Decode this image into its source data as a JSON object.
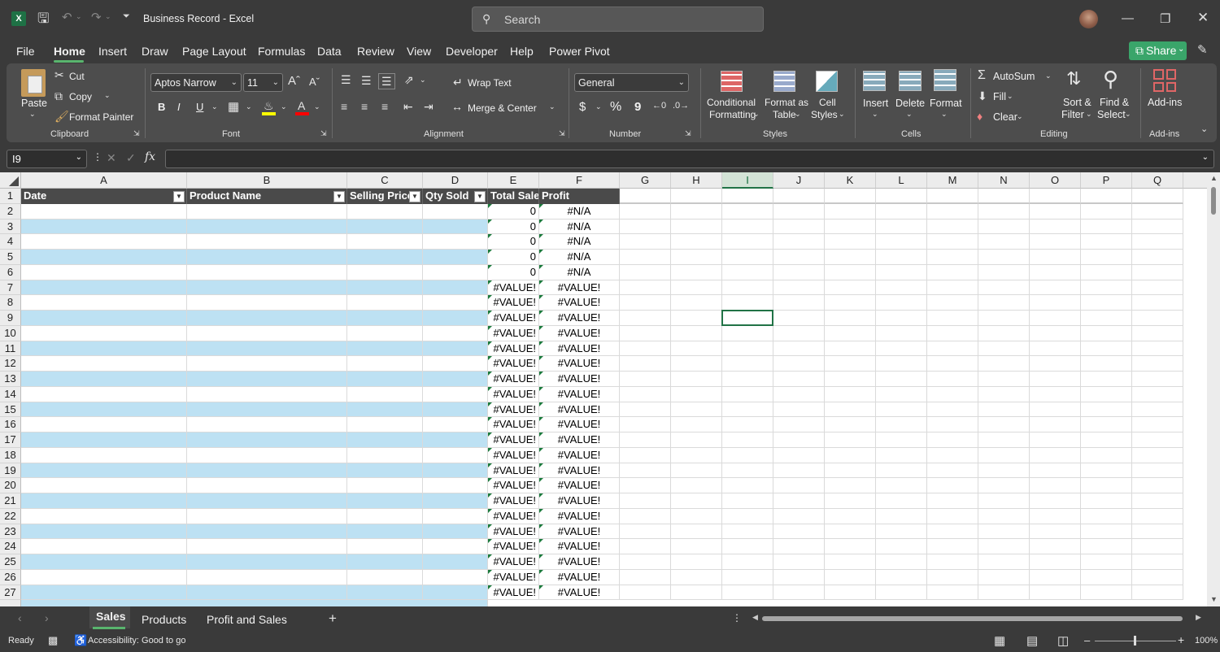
{
  "app": {
    "title": "Business Record  -  Excel",
    "search_placeholder": "Search"
  },
  "menu_tabs": [
    "File",
    "Home",
    "Insert",
    "Draw",
    "Page Layout",
    "Formulas",
    "Data",
    "Review",
    "View",
    "Developer",
    "Help",
    "Power Pivot"
  ],
  "active_tab": "Home",
  "share_label": "Share",
  "ribbon": {
    "clipboard": {
      "label": "Clipboard",
      "paste": "Paste",
      "cut": "Cut",
      "copy": "Copy",
      "format_painter": "Format Painter"
    },
    "font": {
      "label": "Font",
      "name": "Aptos Narrow",
      "size": "11",
      "bold": "B",
      "italic": "I",
      "underline": "U"
    },
    "alignment": {
      "label": "Alignment",
      "wrap_text": "Wrap Text",
      "merge_center": "Merge & Center"
    },
    "number": {
      "label": "Number",
      "format": "General",
      "currency": "$",
      "percent": "%",
      "comma": "9"
    },
    "styles": {
      "label": "Styles",
      "conditional_1": "Conditional",
      "conditional_2": "Formatting",
      "format_table_1": "Format as",
      "format_table_2": "Table",
      "cell_styles_1": "Cell",
      "cell_styles_2": "Styles"
    },
    "cells": {
      "label": "Cells",
      "insert": "Insert",
      "delete": "Delete",
      "format": "Format"
    },
    "editing": {
      "label": "Editing",
      "autosum": "AutoSum",
      "fill": "Fill",
      "clear": "Clear",
      "sort_1": "Sort &",
      "sort_2": "Filter",
      "find_1": "Find &",
      "find_2": "Select"
    },
    "addins": {
      "label": "Add-ins",
      "addins": "Add-ins"
    }
  },
  "formula_bar": {
    "name_box": "I9",
    "formula": ""
  },
  "columns": [
    "A",
    "B",
    "C",
    "D",
    "E",
    "F",
    "G",
    "H",
    "I",
    "J",
    "K",
    "L",
    "M",
    "N",
    "O",
    "P",
    "Q"
  ],
  "selected_column": "I",
  "table_headers": [
    "Date",
    "Product Name",
    "Selling Price",
    "Qty Sold",
    "Total Sale",
    "Profit"
  ],
  "rows": [
    {
      "num": "1"
    },
    {
      "num": "2",
      "e": "0",
      "f": "#N/A"
    },
    {
      "num": "3",
      "e": "0",
      "f": "#N/A"
    },
    {
      "num": "4",
      "e": "0",
      "f": "#N/A"
    },
    {
      "num": "5",
      "e": "0",
      "f": "#N/A"
    },
    {
      "num": "6",
      "e": "0",
      "f": "#N/A"
    },
    {
      "num": "7",
      "e": "#VALUE!",
      "f": "#VALUE!"
    },
    {
      "num": "8",
      "e": "#VALUE!",
      "f": "#VALUE!"
    },
    {
      "num": "9",
      "e": "#VALUE!",
      "f": "#VALUE!"
    },
    {
      "num": "10",
      "e": "#VALUE!",
      "f": "#VALUE!"
    },
    {
      "num": "11",
      "e": "#VALUE!",
      "f": "#VALUE!"
    },
    {
      "num": "12",
      "e": "#VALUE!",
      "f": "#VALUE!"
    },
    {
      "num": "13",
      "e": "#VALUE!",
      "f": "#VALUE!"
    },
    {
      "num": "14",
      "e": "#VALUE!",
      "f": "#VALUE!"
    },
    {
      "num": "15",
      "e": "#VALUE!",
      "f": "#VALUE!"
    },
    {
      "num": "16",
      "e": "#VALUE!",
      "f": "#VALUE!"
    },
    {
      "num": "17",
      "e": "#VALUE!",
      "f": "#VALUE!"
    },
    {
      "num": "18",
      "e": "#VALUE!",
      "f": "#VALUE!"
    },
    {
      "num": "19",
      "e": "#VALUE!",
      "f": "#VALUE!"
    },
    {
      "num": "20",
      "e": "#VALUE!",
      "f": "#VALUE!"
    },
    {
      "num": "21",
      "e": "#VALUE!",
      "f": "#VALUE!"
    },
    {
      "num": "22",
      "e": "#VALUE!",
      "f": "#VALUE!"
    },
    {
      "num": "23",
      "e": "#VALUE!",
      "f": "#VALUE!"
    },
    {
      "num": "24",
      "e": "#VALUE!",
      "f": "#VALUE!"
    },
    {
      "num": "25",
      "e": "#VALUE!",
      "f": "#VALUE!"
    },
    {
      "num": "26",
      "e": "#VALUE!",
      "f": "#VALUE!"
    },
    {
      "num": "27",
      "e": "#VALUE!",
      "f": "#VALUE!"
    }
  ],
  "sheet_tabs": [
    "Sales",
    "Products",
    "Profit and Sales"
  ],
  "active_sheet": "Sales",
  "status": {
    "ready": "Ready",
    "accessibility": "Accessibility: Good to go",
    "zoom": "100%"
  },
  "colors": {
    "accent": "#217346",
    "band": "#bde1f3",
    "header_fill": "#4a4a4a",
    "share": "#3aa56a"
  }
}
